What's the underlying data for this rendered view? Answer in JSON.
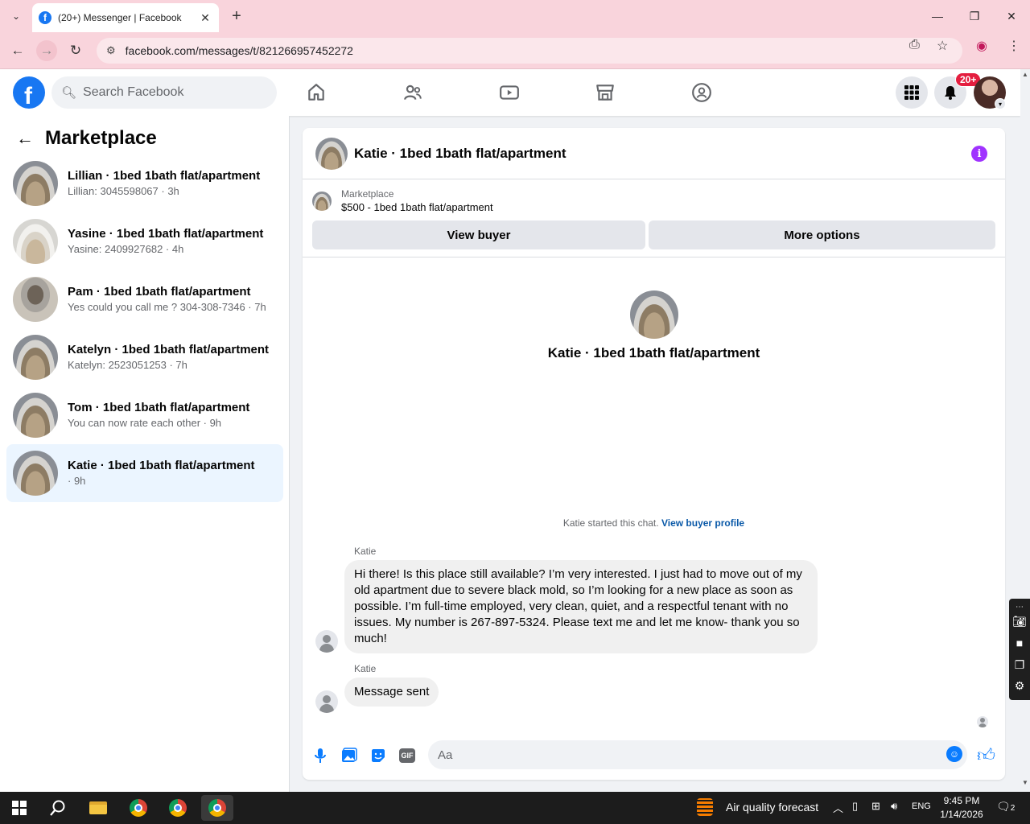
{
  "browser": {
    "tab_title": "(20+) Messenger | Facebook",
    "favicon_letter": "f",
    "url": "facebook.com/messages/t/821266957452272",
    "new_tab": "+",
    "tab_close": "✕"
  },
  "fb_header": {
    "logo_letter": "f",
    "search_placeholder": "Search Facebook",
    "notification_badge": "20+",
    "nav": [
      "home-icon",
      "friends-icon",
      "video-icon",
      "marketplace-icon",
      "groups-icon"
    ]
  },
  "sidebar": {
    "title": "Marketplace",
    "conversations": [
      {
        "name": "Lillian · 1bed 1bath flat/apartment",
        "preview": "Lillian: 3045598067 · 3h",
        "active": false
      },
      {
        "name": "Yasine · 1bed 1bath flat/apartment",
        "preview": "Yasine: 2409927682 · 4h",
        "active": false
      },
      {
        "name": "Pam · 1bed 1bath flat/apartment",
        "preview": "Yes could you call me ? 304-308-7346 · 7h",
        "active": false
      },
      {
        "name": "Katelyn · 1bed 1bath flat/apartment",
        "preview": "Katelyn: 2523051253 · 7h",
        "active": false
      },
      {
        "name": "Tom · 1bed 1bath flat/apartment",
        "preview": "You can now rate each other · 9h",
        "active": false
      },
      {
        "name": "Katie · 1bed 1bath flat/apartment",
        "preview": "· 9h",
        "active": true
      }
    ]
  },
  "chat": {
    "title": "Katie · 1bed 1bath flat/apartment",
    "listing_label": "Marketplace",
    "listing_title": "$500 - 1bed 1bath flat/apartment",
    "view_buyer": "View buyer",
    "more_options": "More options",
    "center_title": "Katie · 1bed 1bath flat/apartment",
    "started_text": "Katie started this chat.",
    "view_buyer_profile": "View buyer profile",
    "messages": [
      {
        "sender": "Katie",
        "text": "Hi there! Is this place still available? I’m very interested. I just had to move out of my old apartment due to severe black mold, so I’m looking for a new place as soon as possible. I’m full-time employed, very clean, quiet, and a respectful tenant with no issues. My number is 267-897-5324. Please text me and let me know- thank you so much!"
      },
      {
        "sender": "Katie",
        "text": "Message sent"
      }
    ],
    "composer_placeholder": "Aa",
    "gif_label": "GIF"
  },
  "taskbar": {
    "air_quality": "Air quality forecast",
    "language": "ENG",
    "time": "9:45 PM",
    "date": "1/14/2026",
    "notification_count": "2"
  },
  "colors": {
    "fb_blue": "#1877f2",
    "messenger_blue": "#0a7cff",
    "chrome_tabbar": "#f9d4dc",
    "badge_red": "#e41e3f",
    "info_purple": "#a033ff"
  }
}
